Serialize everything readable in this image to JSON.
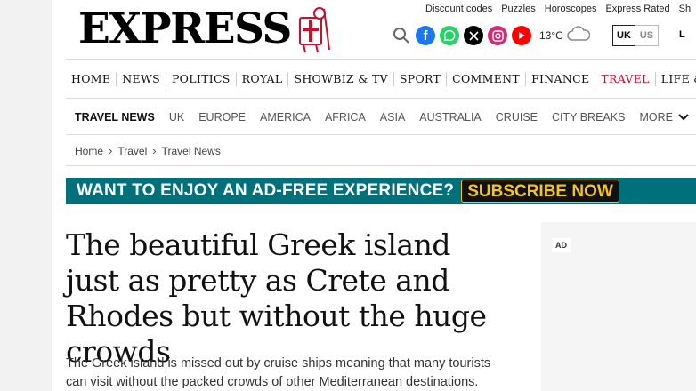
{
  "header": {
    "logo_text": "EXPRESS",
    "top_links": [
      "Discount codes",
      "Puzzles",
      "Horoscopes",
      "Express Rated",
      "Sh"
    ],
    "social_icons": [
      "search-icon",
      "facebook-icon",
      "whatsapp-icon",
      "x-icon",
      "instagram-icon",
      "youtube-icon"
    ],
    "weather": {
      "temperature": "13°C",
      "icon": "cloud-icon"
    },
    "edition": {
      "selected": "UK",
      "other": "US"
    },
    "cut_label": "L"
  },
  "main_nav": {
    "items": [
      "HOME",
      "NEWS",
      "POLITICS",
      "ROYAL",
      "SHOWBIZ & TV",
      "SPORT",
      "COMMENT",
      "FINANCE",
      "TRAVEL",
      "LIFE & STY"
    ],
    "active": "TRAVEL",
    "active_color": "#c8102e"
  },
  "section_nav": {
    "current": "TRAVEL NEWS",
    "items": [
      "UK",
      "EUROPE",
      "AMERICA",
      "AFRICA",
      "ASIA",
      "AUSTRALIA",
      "CRUISE",
      "CITY BREAKS"
    ],
    "more_label": "MORE"
  },
  "breadcrumb": [
    "Home",
    "Travel",
    "Travel News"
  ],
  "banner": {
    "question": "WANT TO ENJOY AN AD-FREE EXPERIENCE?",
    "button": "SUBSCRIBE NOW",
    "background": "#00707a",
    "accent": "#f5c518"
  },
  "article": {
    "headline": "The beautiful Greek island just as pretty as Crete and Rhodes but without the huge crowds",
    "standfirst": "The Greek island is missed out by cruise ships meaning that many tourists can visit without the packed crowds of other Mediterranean destinations."
  },
  "ad": {
    "label": "AD"
  }
}
